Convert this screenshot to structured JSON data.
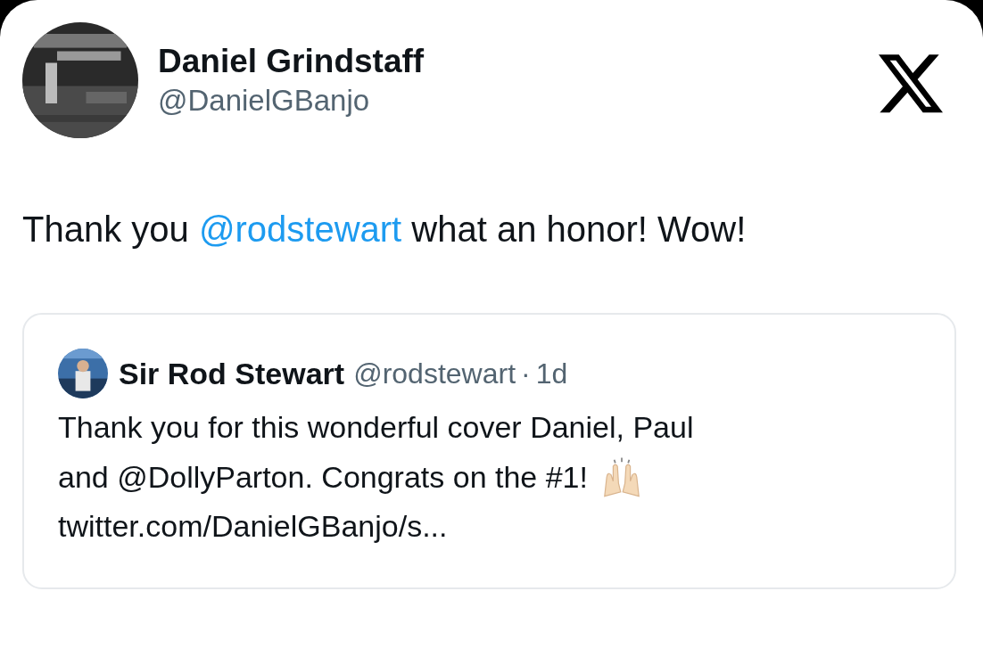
{
  "author": {
    "name": "Daniel Grindstaff",
    "handle": "@DanielGBanjo",
    "avatar": {
      "kind": "picture"
    }
  },
  "tweet": {
    "parts": [
      {
        "text": "Thank you ",
        "kind": "plain"
      },
      {
        "text": "@rodstewart",
        "kind": "mention"
      },
      {
        "text": " what an honor! Wow!",
        "kind": "plain"
      }
    ]
  },
  "quote": {
    "name": "Sir Rod Stewart",
    "handle": "@rodstewart",
    "separator": "·",
    "time": "1d",
    "text_lines": [
      "Thank you for this wonderful cover Daniel, Paul",
      "and @DollyParton. Congrats on the #1!"
    ],
    "link": "twitter.com/DanielGBanjo/s...",
    "avatar": {
      "kind": "picture"
    }
  }
}
